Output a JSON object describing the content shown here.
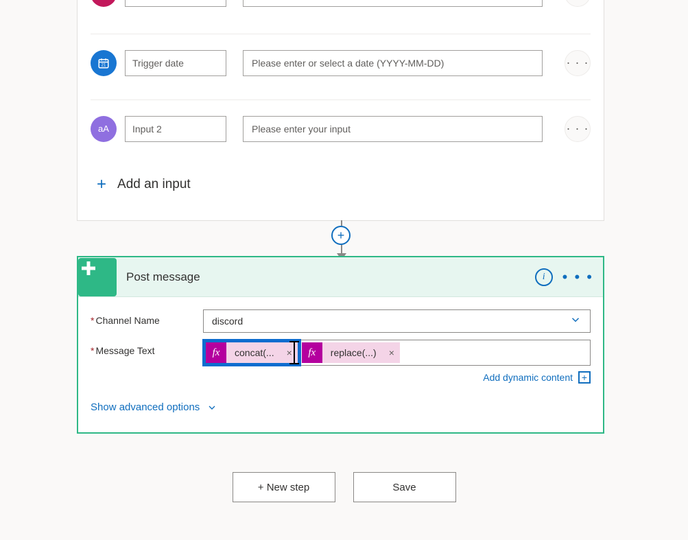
{
  "trigger": {
    "params": [
      {
        "name": "",
        "placeholder": ""
      },
      {
        "name": "Trigger date",
        "placeholder": "Please enter or select a date (YYYY-MM-DD)"
      },
      {
        "name": "Input 2",
        "placeholder": "Please enter your input"
      }
    ],
    "add_input_label": "Add an input"
  },
  "connector": {
    "plus": "+"
  },
  "action": {
    "title": "Post message",
    "fields": {
      "channel": {
        "label": "Channel Name",
        "value": "discord"
      },
      "message": {
        "label": "Message Text",
        "tokens": [
          {
            "fx": "fx",
            "label": "concat(...",
            "remove": "×"
          },
          {
            "fx": "fx",
            "label": "replace(...)",
            "remove": "×"
          }
        ]
      }
    },
    "dynamic_content_label": "Add dynamic content",
    "advanced_label": "Show advanced options"
  },
  "buttons": {
    "new_step": "+ New step",
    "save": "Save"
  },
  "menu_dots": "• • •",
  "ellipsis": "· · ·",
  "plus": "+",
  "chevron_down": "⌄",
  "info": "i",
  "box_plus": "+"
}
